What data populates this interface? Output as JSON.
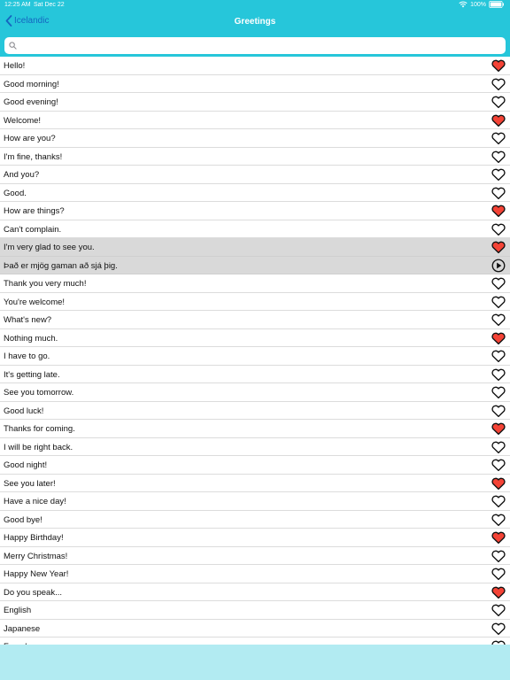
{
  "status": {
    "time": "12:25 AM",
    "date": "Sat Dec 22",
    "battery": "100%"
  },
  "nav": {
    "back_label": "Icelandic",
    "title": "Greetings"
  },
  "search": {
    "placeholder": "",
    "value": ""
  },
  "colors": {
    "header": "#26c6da",
    "back": "#1565c0",
    "heart_red": "#f44336",
    "bottom_bar": "#b2ebf2",
    "selected_row": "#d9d9d9"
  },
  "rows": [
    {
      "text": "Hello!",
      "icon": "heart-filled",
      "favorite": true
    },
    {
      "text": "Good morning!",
      "icon": "heart-outline",
      "favorite": false
    },
    {
      "text": "Good evening!",
      "icon": "heart-outline",
      "favorite": false
    },
    {
      "text": "Welcome!",
      "icon": "heart-filled",
      "favorite": true
    },
    {
      "text": "How are you?",
      "icon": "heart-outline",
      "favorite": false
    },
    {
      "text": "I'm fine, thanks!",
      "icon": "heart-outline",
      "favorite": false
    },
    {
      "text": "And you?",
      "icon": "heart-outline",
      "favorite": false
    },
    {
      "text": "Good.",
      "icon": "heart-outline",
      "favorite": false
    },
    {
      "text": "How are things?",
      "icon": "heart-filled",
      "favorite": true
    },
    {
      "text": "Can't complain.",
      "icon": "heart-outline",
      "favorite": false
    },
    {
      "text": "I'm very glad to see you.",
      "icon": "heart-filled",
      "favorite": true,
      "selected": true
    },
    {
      "text": "Það er mjög gaman að sjá þig.",
      "icon": "play",
      "selected": true
    },
    {
      "text": "Thank you very much!",
      "icon": "heart-outline",
      "favorite": false
    },
    {
      "text": "You're welcome!",
      "icon": "heart-outline",
      "favorite": false
    },
    {
      "text": "What's new?",
      "icon": "heart-outline",
      "favorite": false
    },
    {
      "text": "Nothing much.",
      "icon": "heart-filled",
      "favorite": true
    },
    {
      "text": "I have to go.",
      "icon": "heart-outline",
      "favorite": false
    },
    {
      "text": "It's getting late.",
      "icon": "heart-outline",
      "favorite": false
    },
    {
      "text": "See you tomorrow.",
      "icon": "heart-outline",
      "favorite": false
    },
    {
      "text": "Good luck!",
      "icon": "heart-outline",
      "favorite": false
    },
    {
      "text": "Thanks for coming.",
      "icon": "heart-filled",
      "favorite": true
    },
    {
      "text": "I will be right back.",
      "icon": "heart-outline",
      "favorite": false
    },
    {
      "text": "Good night!",
      "icon": "heart-outline",
      "favorite": false
    },
    {
      "text": "See you later!",
      "icon": "heart-filled",
      "favorite": true
    },
    {
      "text": "Have a nice day!",
      "icon": "heart-outline",
      "favorite": false
    },
    {
      "text": "Good bye!",
      "icon": "heart-outline",
      "favorite": false
    },
    {
      "text": "Happy Birthday!",
      "icon": "heart-filled",
      "favorite": true
    },
    {
      "text": "Merry Christmas!",
      "icon": "heart-outline",
      "favorite": false
    },
    {
      "text": "Happy New Year!",
      "icon": "heart-outline",
      "favorite": false
    },
    {
      "text": "Do you speak...",
      "icon": "heart-filled",
      "favorite": true
    },
    {
      "text": "English",
      "icon": "heart-outline",
      "favorite": false
    },
    {
      "text": "Japanese",
      "icon": "heart-outline",
      "favorite": false
    },
    {
      "text": "French",
      "icon": "heart-outline",
      "favorite": false
    }
  ]
}
